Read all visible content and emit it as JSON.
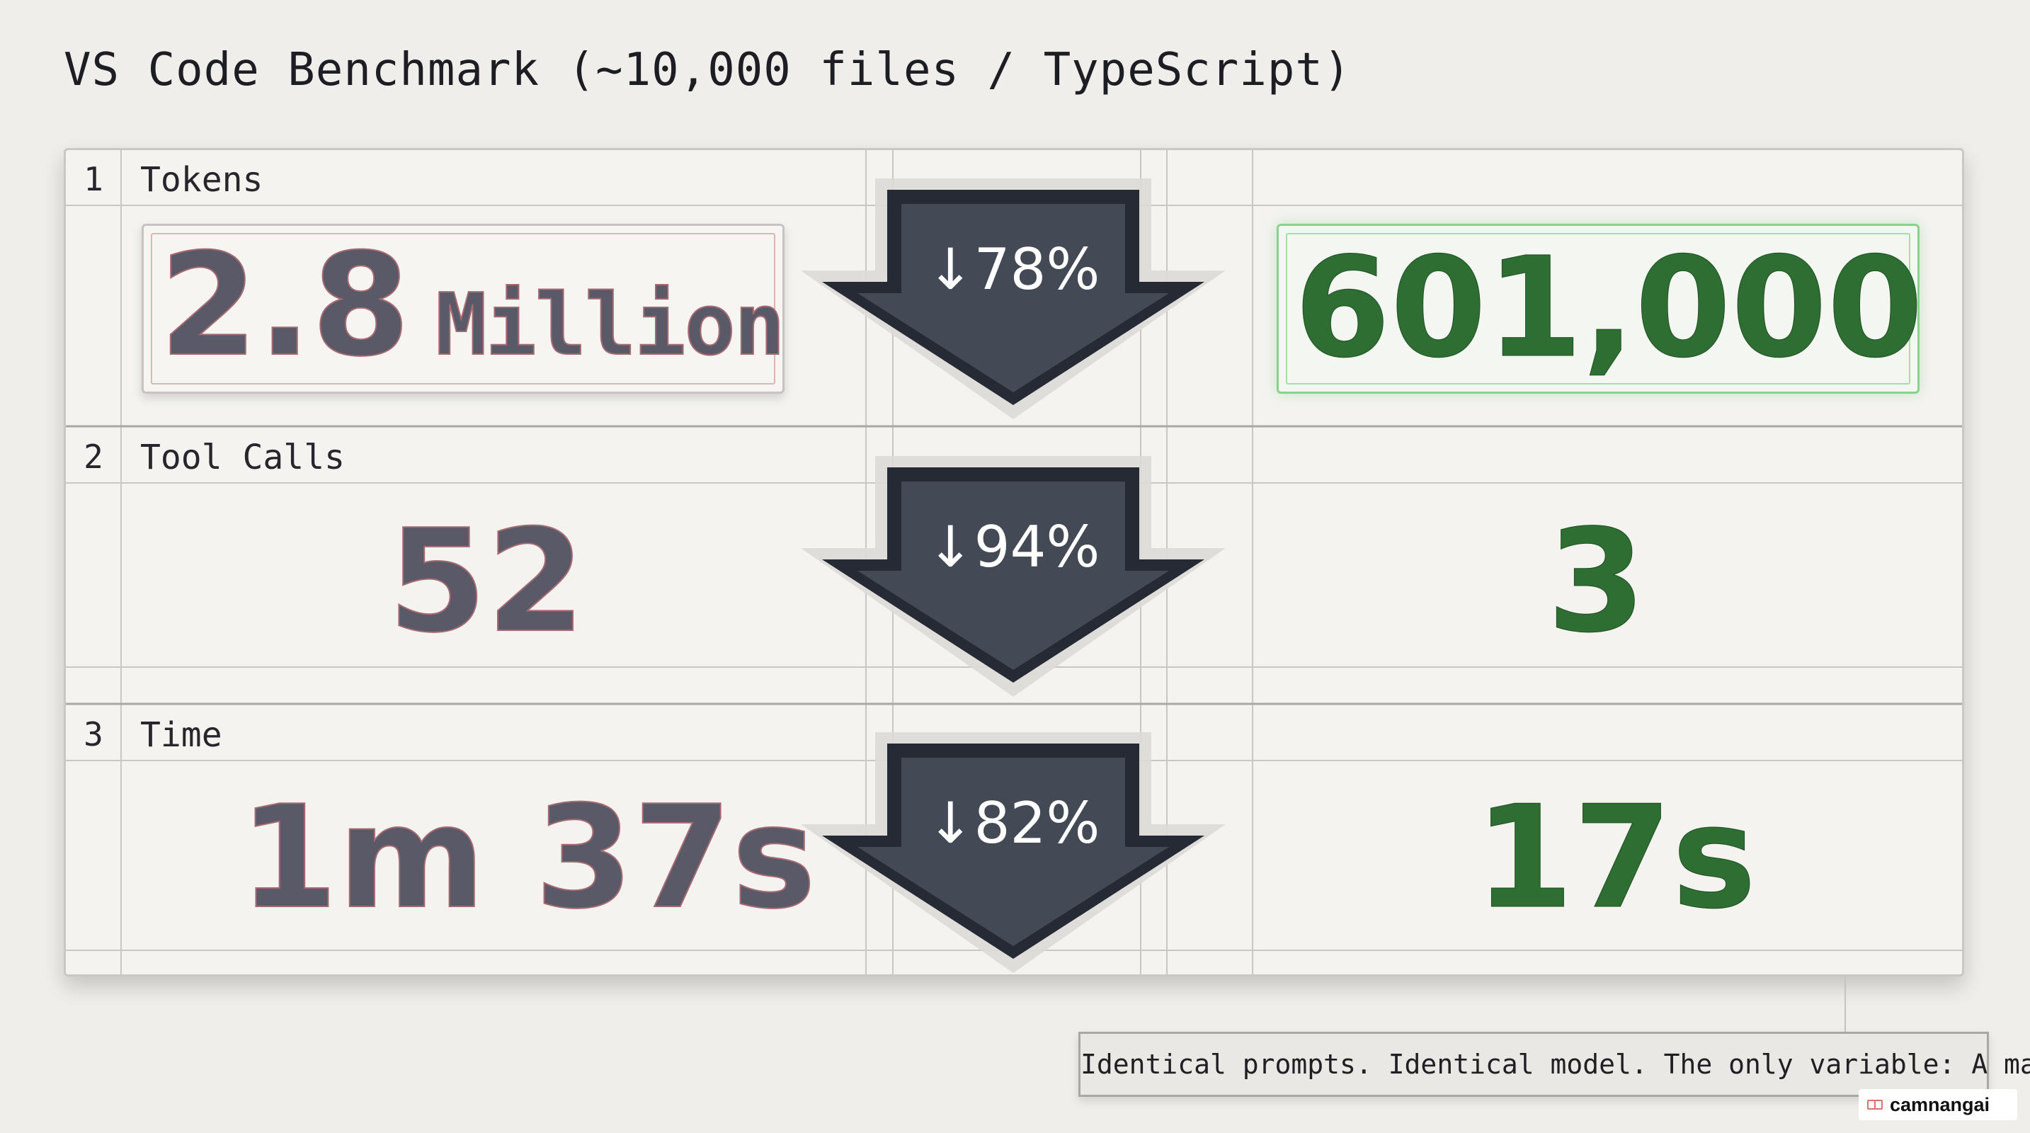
{
  "title": "VS Code Benchmark (~10,000 files / TypeScript)",
  "rows": [
    {
      "num": "1",
      "label": "Tokens",
      "before": "2.8",
      "before_unit": "Million",
      "change": "↓78%",
      "after": "601,000"
    },
    {
      "num": "2",
      "label": "Tool Calls",
      "before": "52",
      "change": "↓94%",
      "after": "3"
    },
    {
      "num": "3",
      "label": "Time",
      "before": "1m 37s",
      "change": "↓82%",
      "after": "17s"
    }
  ],
  "caption": "Identical prompts. Identical model. The only variable: A map.",
  "watermark": "camnangai",
  "colors": {
    "background": "#efeeea",
    "before_text": "#5a5968",
    "after_text": "#2e6e33",
    "arrow": "#3c414c",
    "highlight_border": "#8ccf90"
  }
}
